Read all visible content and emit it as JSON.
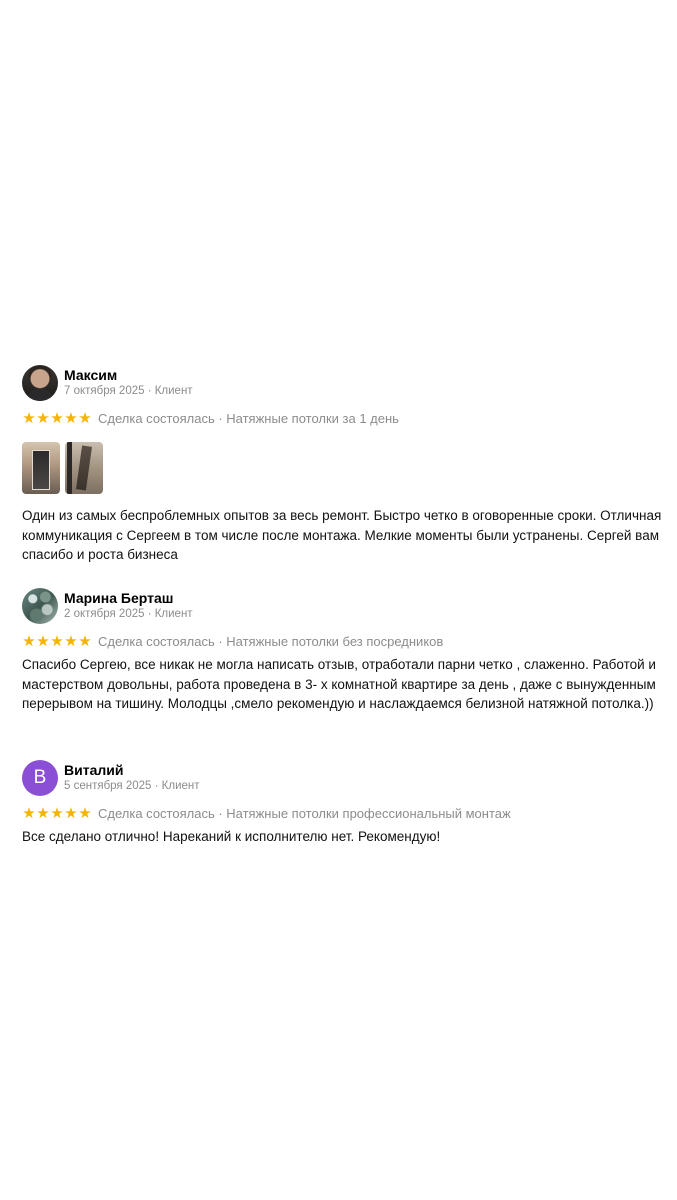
{
  "reviews": [
    {
      "author": "Максим",
      "date": "7 октября 2025 · Клиент",
      "rating": 5,
      "stars": [
        "★",
        "★",
        "★",
        "★",
        "★"
      ],
      "deal": "Сделка состоялась · Натяжные потолки за 1 день",
      "photos_count": 2,
      "text": "Один из самых беспроблемных опытов за весь ремонт. Быстро четко в оговоренные сроки. Отличная коммуникация с Сергеем в том числе после монтажа. Мелкие моменты были устранены. Сергей вам спасибо и роста бизнеса"
    },
    {
      "author": "Марина Берташ",
      "date": "2 октября 2025 · Клиент",
      "rating": 5,
      "stars": [
        "★",
        "★",
        "★",
        "★",
        "★"
      ],
      "deal": "Сделка состоялась · Натяжные потолки без посредников",
      "text": "Спасибо Сергею, все никак не могла написать отзыв, отработали парни четко , слаженно. Работой и мастерством довольны, работа проведена в 3- х комнатной квартире за день , даже с вынужденным перерывом на тишину. Молодцы ,смело рекомендую и наслаждаемся белизной натяжной потолка.))"
    },
    {
      "author": "Виталий",
      "avatar_letter": "В",
      "avatar_color": "#8a4fd4",
      "date": "5 сентября 2025 · Клиент",
      "rating": 5,
      "stars": [
        "★",
        "★",
        "★",
        "★",
        "★"
      ],
      "deal": "Сделка состоялась · Натяжные потолки профессиональный монтаж",
      "text": "Все сделано отлично! Нареканий к исполнителю нет. Рекомендую!"
    }
  ],
  "colors": {
    "star": "#f5b400",
    "muted_text": "#8c8c8c",
    "main_text": "#111111"
  }
}
